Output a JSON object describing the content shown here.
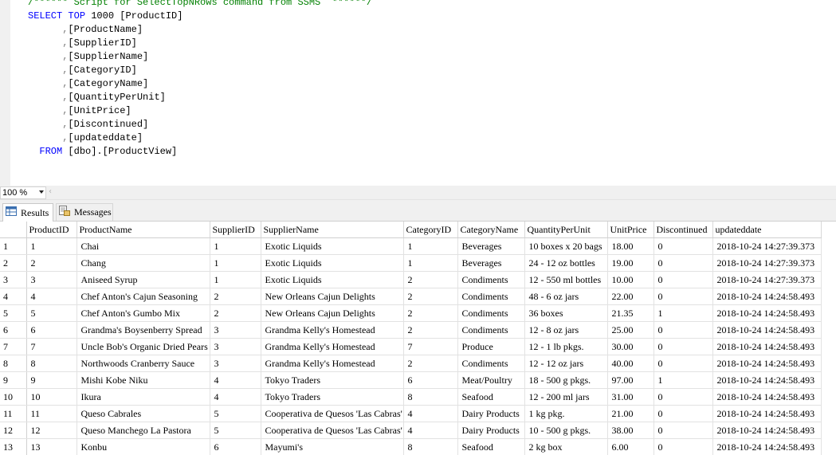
{
  "editor": {
    "comment": "/****** Script for SelectTopNRows command from SSMS  ******/",
    "select_kw": "SELECT",
    "top_kw": "TOP",
    "top_value": "1000",
    "first_col": "[ProductID]",
    "other_cols": [
      "[ProductName]",
      "[SupplierID]",
      "[SupplierName]",
      "[CategoryID]",
      "[CategoryName]",
      "[QuantityPerUnit]",
      "[UnitPrice]",
      "[Discontinued]",
      "[updateddate]"
    ],
    "from_kw": "FROM",
    "from_source": "[dbo].[ProductView]"
  },
  "zoom": {
    "value": "100 %"
  },
  "tabs": {
    "results": "Results",
    "messages": "Messages"
  },
  "grid": {
    "columns": [
      "ProductID",
      "ProductName",
      "SupplierID",
      "SupplierName",
      "CategoryID",
      "CategoryName",
      "QuantityPerUnit",
      "UnitPrice",
      "Discontinued",
      "updateddate"
    ],
    "rows": [
      [
        "1",
        "1",
        "Chai",
        "1",
        "Exotic Liquids",
        "1",
        "Beverages",
        "10 boxes x 20 bags",
        "18.00",
        "0",
        "2018-10-24 14:27:39.373"
      ],
      [
        "2",
        "2",
        "Chang",
        "1",
        "Exotic Liquids",
        "1",
        "Beverages",
        "24 - 12 oz bottles",
        "19.00",
        "0",
        "2018-10-24 14:27:39.373"
      ],
      [
        "3",
        "3",
        "Aniseed Syrup",
        "1",
        "Exotic Liquids",
        "2",
        "Condiments",
        "12 - 550 ml bottles",
        "10.00",
        "0",
        "2018-10-24 14:27:39.373"
      ],
      [
        "4",
        "4",
        "Chef Anton's Cajun Seasoning",
        "2",
        "New Orleans Cajun Delights",
        "2",
        "Condiments",
        "48 - 6 oz jars",
        "22.00",
        "0",
        "2018-10-24 14:24:58.493"
      ],
      [
        "5",
        "5",
        "Chef Anton's Gumbo Mix",
        "2",
        "New Orleans Cajun Delights",
        "2",
        "Condiments",
        "36 boxes",
        "21.35",
        "1",
        "2018-10-24 14:24:58.493"
      ],
      [
        "6",
        "6",
        "Grandma's Boysenberry Spread",
        "3",
        "Grandma Kelly's Homestead",
        "2",
        "Condiments",
        "12 - 8 oz jars",
        "25.00",
        "0",
        "2018-10-24 14:24:58.493"
      ],
      [
        "7",
        "7",
        "Uncle Bob's Organic Dried Pears",
        "3",
        "Grandma Kelly's Homestead",
        "7",
        "Produce",
        "12 - 1 lb pkgs.",
        "30.00",
        "0",
        "2018-10-24 14:24:58.493"
      ],
      [
        "8",
        "8",
        "Northwoods Cranberry Sauce",
        "3",
        "Grandma Kelly's Homestead",
        "2",
        "Condiments",
        "12 - 12 oz jars",
        "40.00",
        "0",
        "2018-10-24 14:24:58.493"
      ],
      [
        "9",
        "9",
        "Mishi Kobe Niku",
        "4",
        "Tokyo Traders",
        "6",
        "Meat/Poultry",
        "18 - 500 g pkgs.",
        "97.00",
        "1",
        "2018-10-24 14:24:58.493"
      ],
      [
        "10",
        "10",
        "Ikura",
        "4",
        "Tokyo Traders",
        "8",
        "Seafood",
        "12 - 200 ml jars",
        "31.00",
        "0",
        "2018-10-24 14:24:58.493"
      ],
      [
        "11",
        "11",
        "Queso Cabrales",
        "5",
        "Cooperativa de Quesos 'Las Cabras'",
        "4",
        "Dairy Products",
        "1 kg pkg.",
        "21.00",
        "0",
        "2018-10-24 14:24:58.493"
      ],
      [
        "12",
        "12",
        "Queso Manchego La Pastora",
        "5",
        "Cooperativa de Quesos 'Las Cabras'",
        "4",
        "Dairy Products",
        "10 - 500 g pkgs.",
        "38.00",
        "0",
        "2018-10-24 14:24:58.493"
      ],
      [
        "13",
        "13",
        "Konbu",
        "6",
        "Mayumi's",
        "8",
        "Seafood",
        "2 kg box",
        "6.00",
        "0",
        "2018-10-24 14:24:58.493"
      ]
    ]
  }
}
